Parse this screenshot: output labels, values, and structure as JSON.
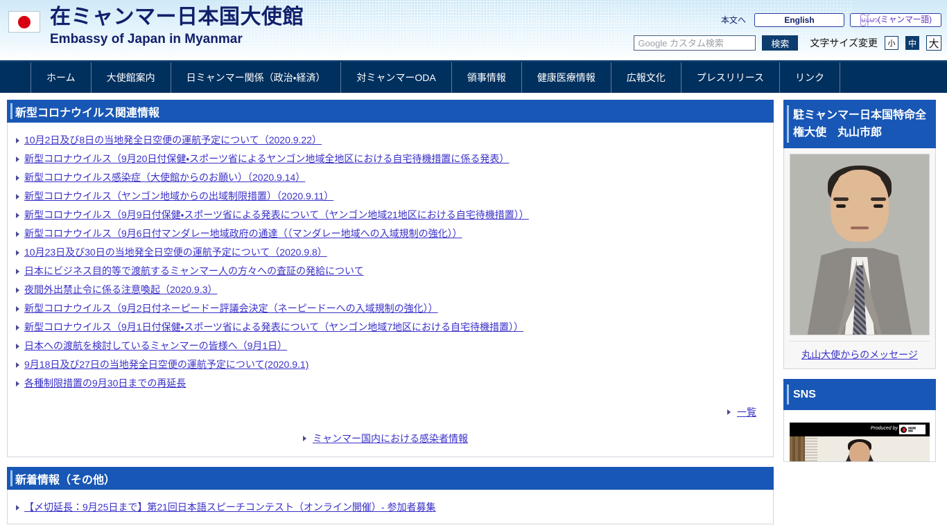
{
  "header": {
    "flag_icon": "japan-flag-icon",
    "title_jp": "在ミャンマー日本国大使館",
    "title_en": "Embassy of Japan in Myanmar",
    "skip_link": "本文へ",
    "lang_english": "English",
    "lang_myanmar": "မြန်မာ(ミャンマー語)",
    "search_placeholder": "Google カスタム検索",
    "search_value": "",
    "search_button": "検索",
    "fontsize_label": "文字サイズ変更",
    "fontsize_small": "小",
    "fontsize_medium": "中",
    "fontsize_large": "大",
    "fontsize_selected": "中"
  },
  "nav": {
    "items": [
      {
        "label": "ホーム"
      },
      {
        "label": "大使館案内"
      },
      {
        "label": "日ミャンマー関係（政治・経済）"
      },
      {
        "label": "対ミャンマーODA"
      },
      {
        "label": "領事情報"
      },
      {
        "label": "健康医療情報"
      },
      {
        "label": "広報文化"
      },
      {
        "label": "プレスリリース"
      },
      {
        "label": "リンク"
      }
    ]
  },
  "corona_section": {
    "title": "新型コロナウイルス関連情報",
    "items": [
      {
        "label": "10月2日及び8日の当地発全日空便の運航予定について（2020.9.22）"
      },
      {
        "label": "新型コロナウイルス（9月20日付保健・スポーツ省によるヤンゴン地域全地区における自宅待機措置に係る発表）"
      },
      {
        "label": "新型コロナウイルス感染症（大使館からのお願い）（2020.9.14）"
      },
      {
        "label": "新型コロナウイルス（ヤンゴン地域からの出域制限措置）（2020.9.11）"
      },
      {
        "label": "新型コロナウイルス（9月9日付保健・スポーツ省による発表について（ヤンゴン地域21地区における自宅待機措置））"
      },
      {
        "label": "新型コロナウイルス（9月6日付マンダレー地域政府の通達（（マンダレー地域への入域規制の強化））"
      },
      {
        "label": "10月23日及び30日の当地発全日空便の運航予定について（2020.9.8）"
      },
      {
        "label": "日本にビジネス目的等で渡航するミャンマー人の方々への査証の発給について"
      },
      {
        "label": "夜間外出禁止令に係る注意喚起（2020.9.3）"
      },
      {
        "label": "新型コロナウイルス（9月2日付ネーピードー評議会決定（ネーピードーへの入域規制の強化））"
      },
      {
        "label": "新型コロナウイルス（9月1日付保健・スポーツ省による発表について（ヤンゴン地域7地区における自宅待機措置））"
      },
      {
        "label": "日本への渡航を検討しているミャンマーの皆様へ（9月1日）"
      },
      {
        "label": "9月18日及び27日の当地発全日空便の運航予定について(2020.9.1)"
      },
      {
        "label": "各種制限措置の9月30日までの再延長"
      }
    ],
    "more_label": "一覧",
    "infection_link": "ミャンマー国内における感染者情報"
  },
  "news_section": {
    "title": "新着情報（その他）",
    "items": [
      {
        "label": "【〆切延長：9月25日まで】第21回日本語スピーチコンテスト（オンライン開催）- 参加者募集"
      }
    ]
  },
  "sidebar": {
    "ambassador": {
      "title": "駐ミャンマー日本国特命全権大使　丸山市郎",
      "photo_alt": "ambassador-portrait",
      "message_link": "丸山大使からのメッセージ"
    },
    "sns": {
      "title": "SNS",
      "video_produced_by": "Produced by"
    }
  },
  "colors": {
    "nav_bg": "#00305e",
    "section_header_bg": "#1857b5",
    "link": "#3a31c8",
    "header_gradient_top": "#cfe9f7",
    "flag_red": "#d90012",
    "brand_text": "#11206b"
  }
}
